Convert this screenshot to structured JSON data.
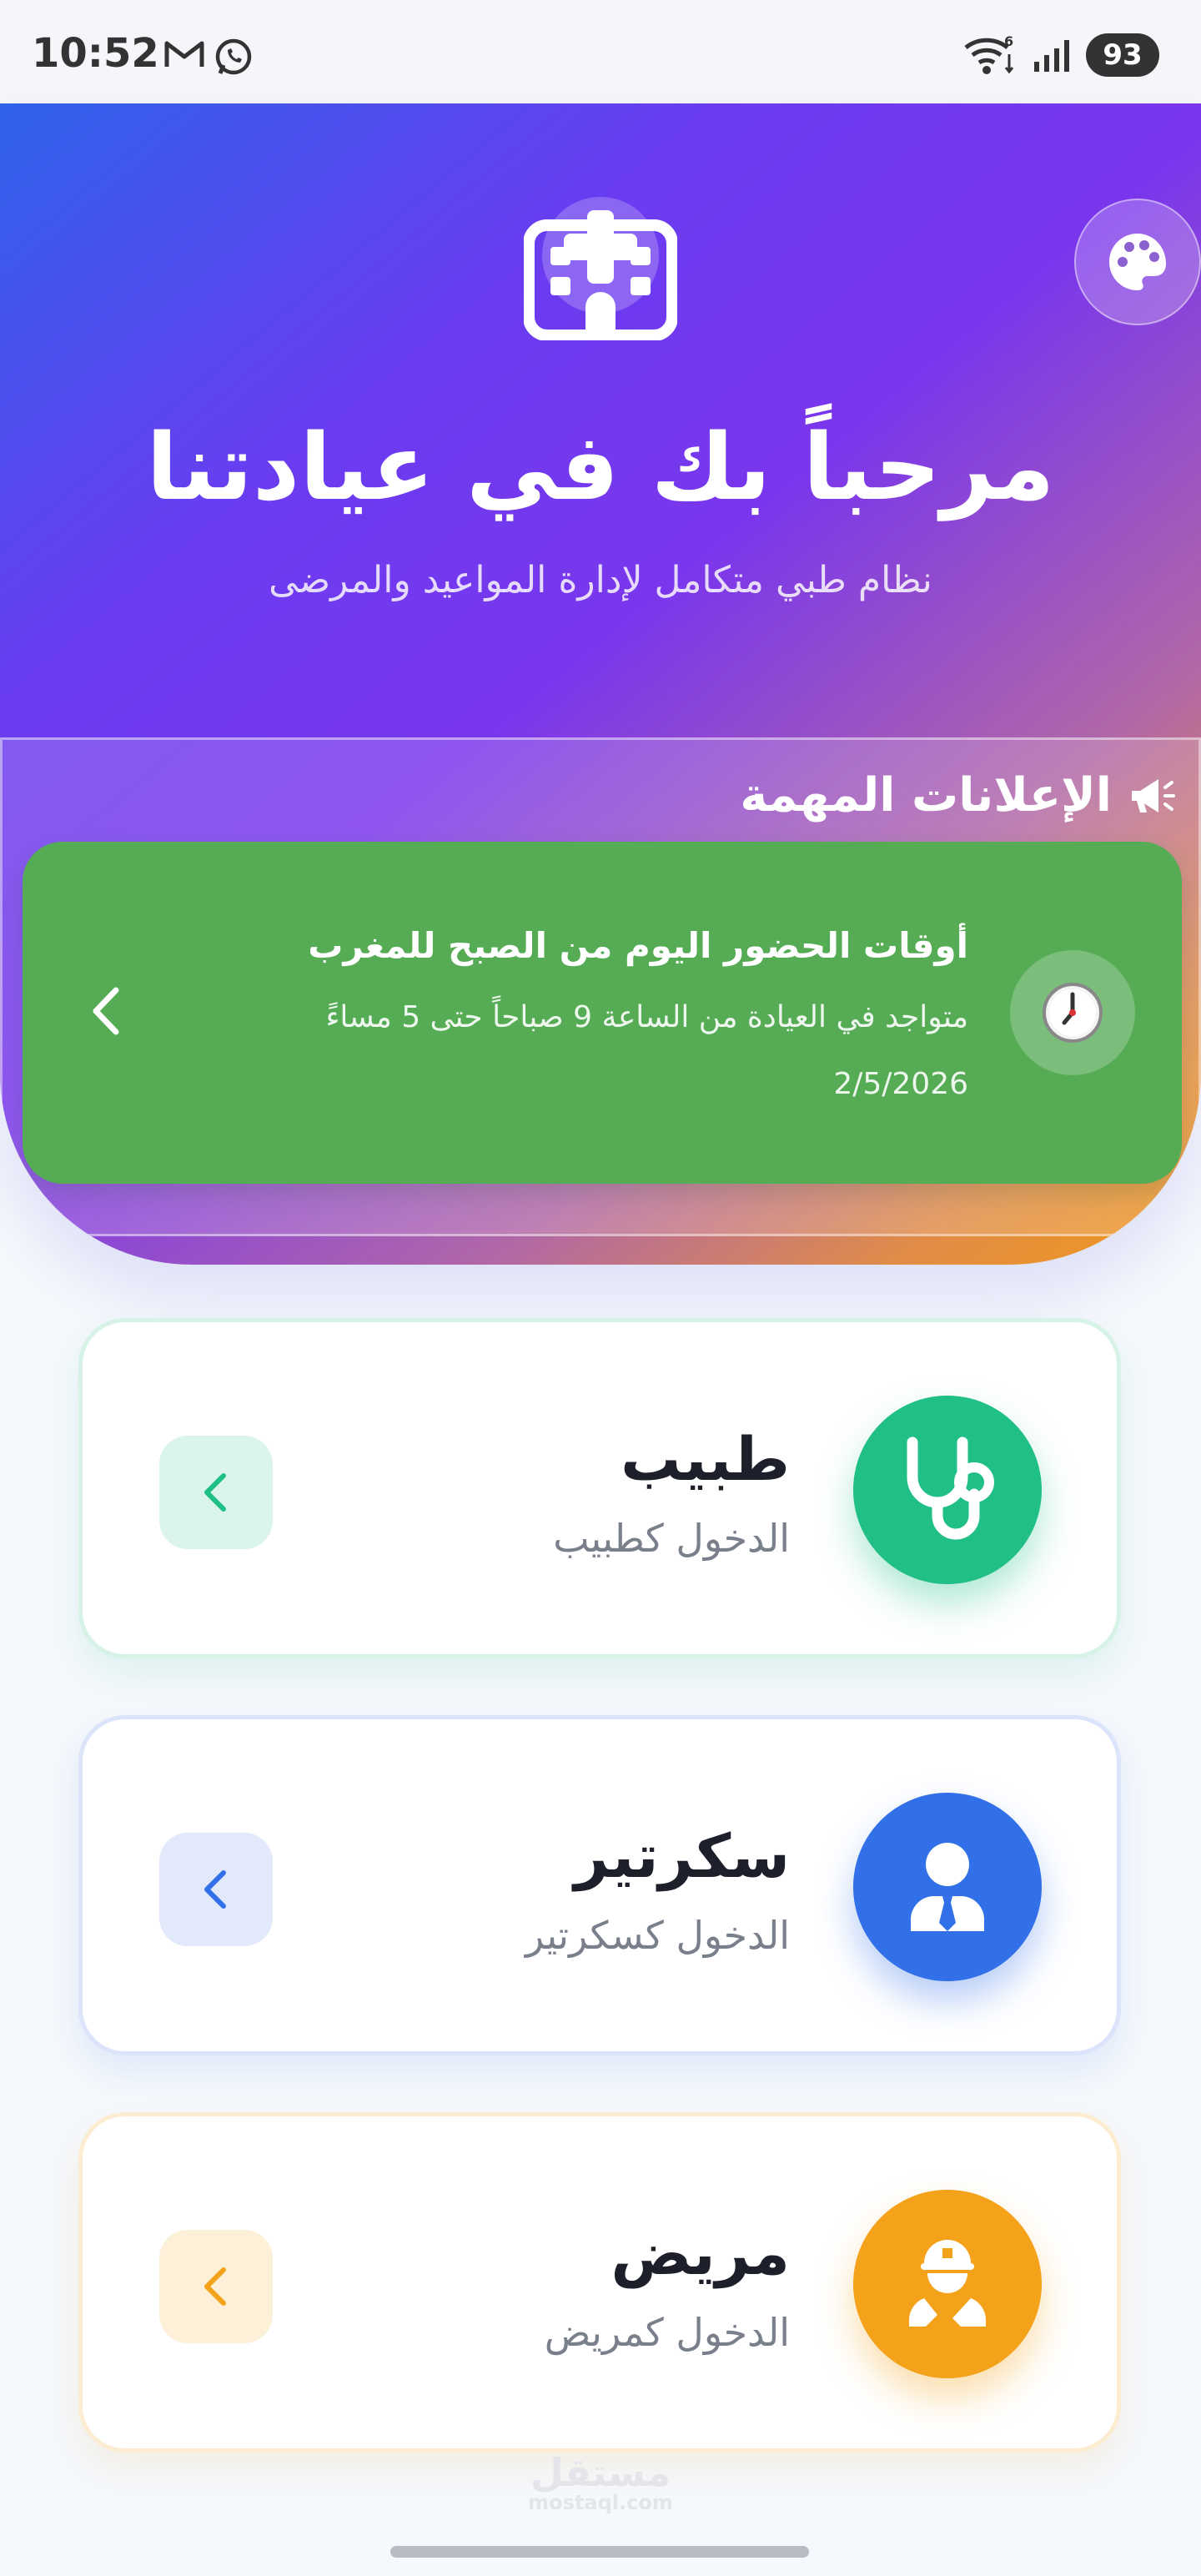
{
  "status_bar": {
    "time": "10:52",
    "battery": "93",
    "wifi_sub": "6"
  },
  "hero": {
    "title": "مرحباً بك في عيادتنا",
    "subtitle": "نظام طبي متكامل لإدارة المواعيد والمرضى",
    "logo_icon": "hospital-icon",
    "theme_icon": "palette-icon"
  },
  "announcements": {
    "header": "الإعلانات المهمة",
    "header_icon": "megaphone-icon",
    "items": [
      {
        "title": "أوقات الحضور اليوم من الصبح للمغرب",
        "text": "متواجد في العيادة من الساعة 9 صباحاً حتى 5 مساءً",
        "date": "2/5/2026",
        "icon": "clock-icon",
        "color": "#56ab55"
      }
    ]
  },
  "roles": [
    {
      "title": "طبيب",
      "subtitle": "الدخول كطبيب",
      "icon": "stethoscope-icon",
      "color": "#20bf86"
    },
    {
      "title": "سكرتير",
      "subtitle": "الدخول كسكرتير",
      "icon": "user-tie-icon",
      "color": "#3170e8"
    },
    {
      "title": "مريض",
      "subtitle": "الدخول كمريض",
      "icon": "hospital-user-icon",
      "color": "#f3a21a"
    }
  ],
  "watermark": {
    "main": "مستقل",
    "sub": "mostaql.com"
  }
}
